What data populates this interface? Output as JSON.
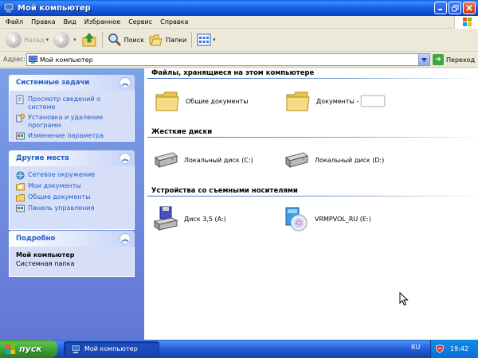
{
  "window": {
    "title": "Мой компьютер"
  },
  "menu": [
    "Файл",
    "Правка",
    "Вид",
    "Избранное",
    "Сервис",
    "Справка"
  ],
  "toolbar": {
    "back": "Назад",
    "search": "Поиск",
    "folders": "Папки"
  },
  "address": {
    "label": "Адрес:",
    "value": "Мой компьютер",
    "go": "Переход"
  },
  "taskpane": {
    "system": {
      "title": "Системные задачи",
      "links": [
        "Просмотр сведений о системе",
        "Установка и удаление программ",
        "Изменение параметра"
      ]
    },
    "places": {
      "title": "Другие места",
      "links": [
        "Сетевое окружение",
        "Мои документы",
        "Общие документы",
        "Панель управления"
      ]
    },
    "details": {
      "title": "Подробно",
      "name": "Мой компьютер",
      "type": "Системная папка"
    }
  },
  "content": {
    "groups": [
      {
        "title": "Файлы, хранящиеся на этом компьютере",
        "items": [
          "Общие документы",
          "Документы -"
        ]
      },
      {
        "title": "Жесткие диски",
        "items": [
          "Локальный диск (C:)",
          "Локальный диск (D:)"
        ]
      },
      {
        "title": "Устройства со съемными носителями",
        "items": [
          "Диск 3,5 (A:)",
          "VRMPVOL_RU (E:)"
        ]
      }
    ]
  },
  "taskbar": {
    "start": "пуск",
    "task": "Мой компьютер",
    "lang": "RU",
    "clock": "19:42"
  },
  "colors": {
    "title_bar": "#0b4bd2",
    "taskpane": "#6375d6",
    "link": "#215dc6",
    "start": "#3b9e33"
  }
}
